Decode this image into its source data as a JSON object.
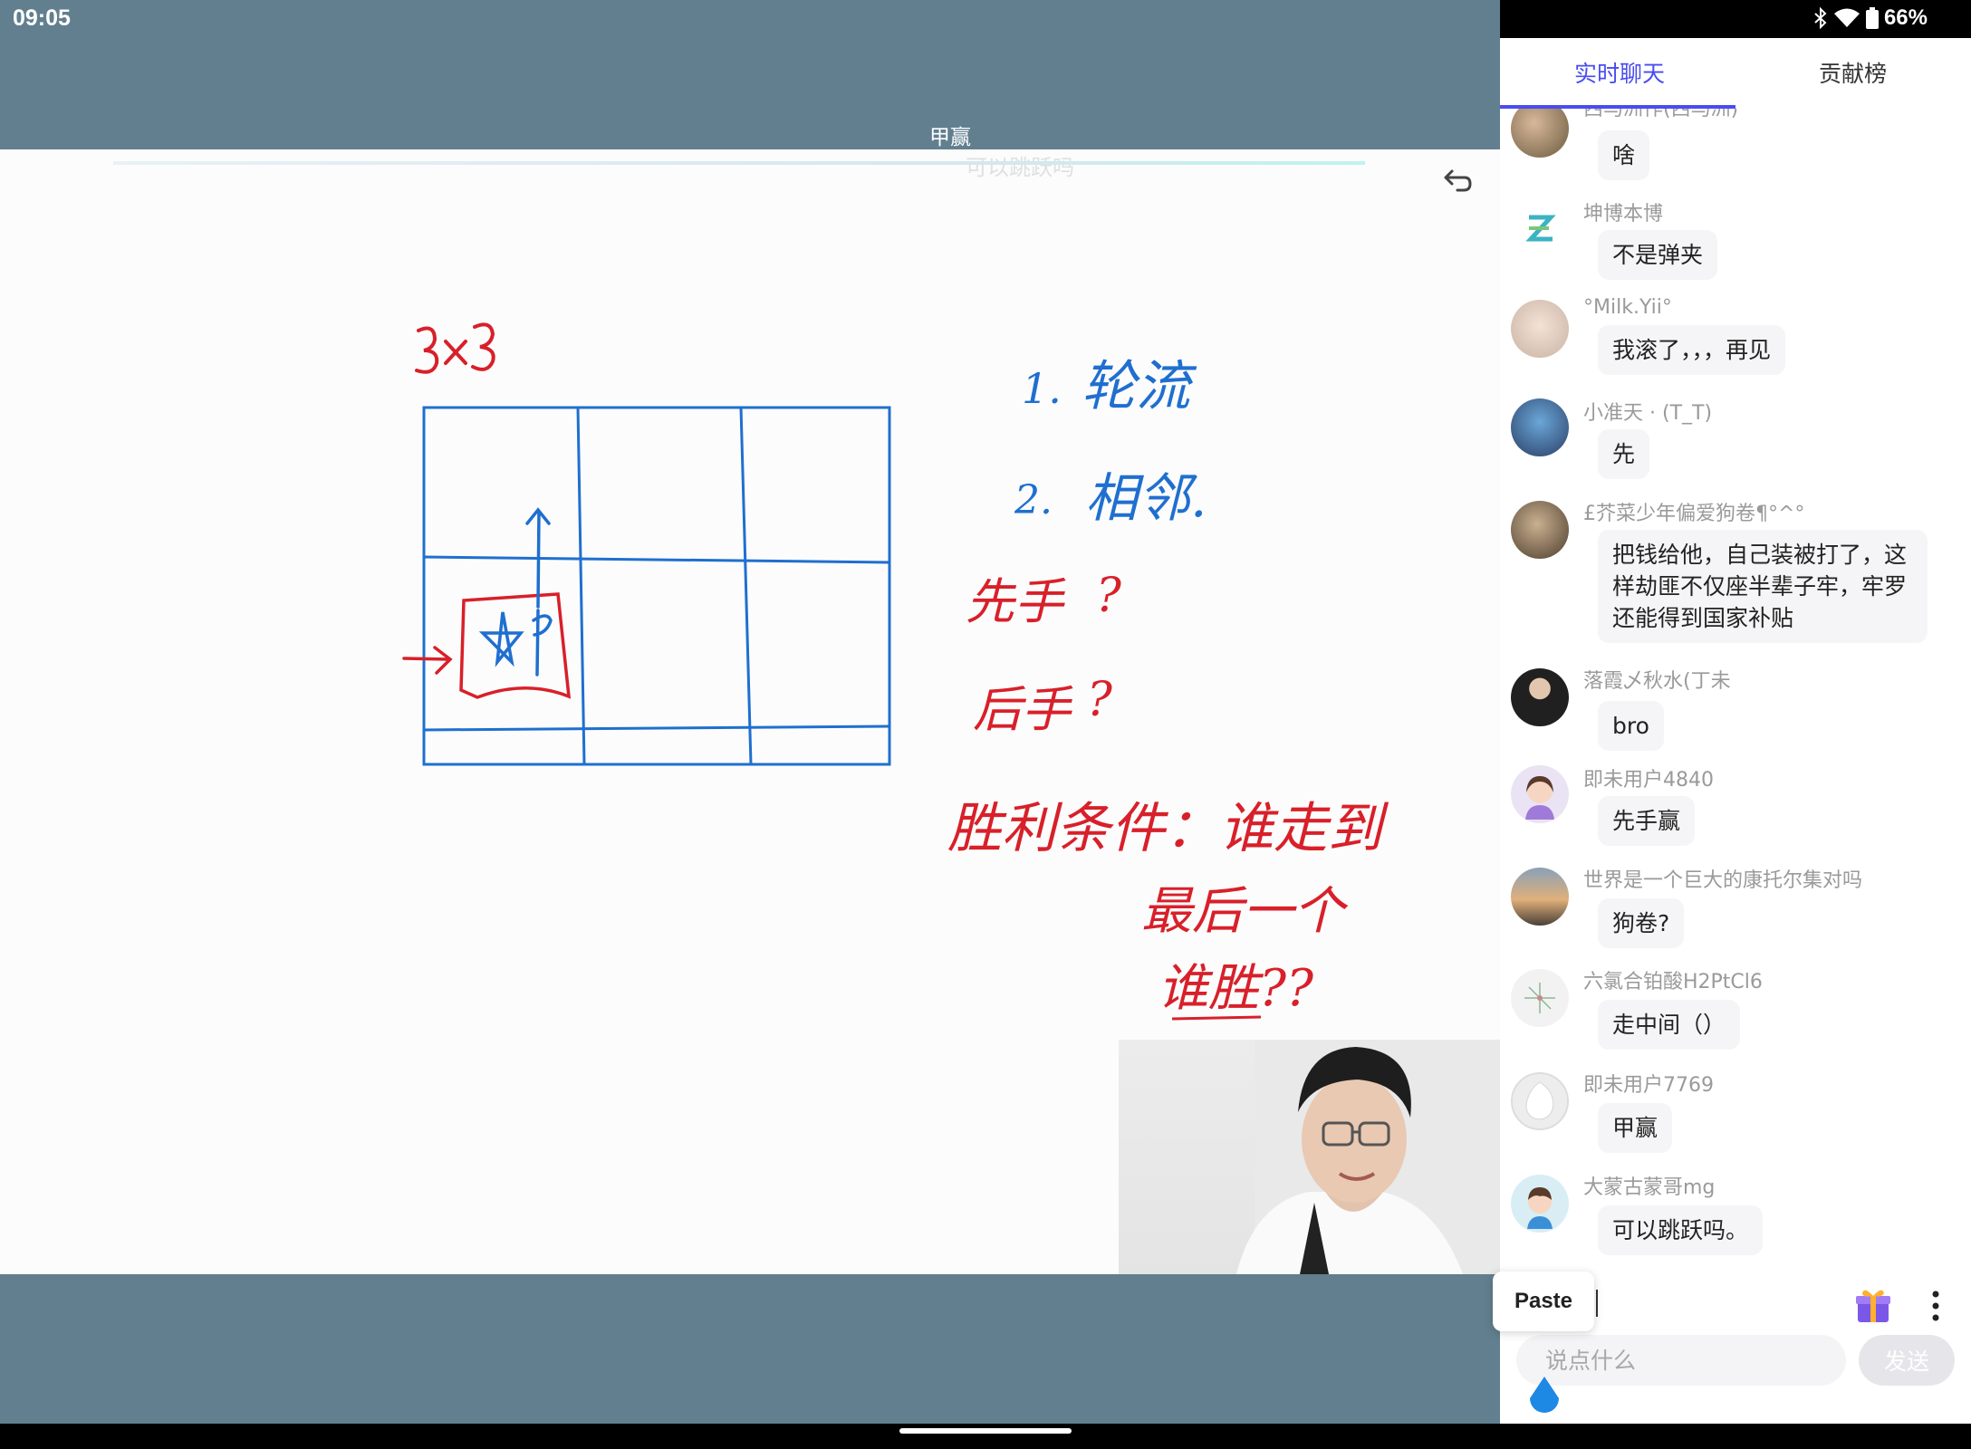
{
  "status_bar": {
    "time": "09:05",
    "battery": "66%"
  },
  "live": {
    "danmaku_top": "甲赢",
    "danmaku_ghost": "可以跳跃吗"
  },
  "whiteboard": {
    "ink_blue": "#1f6fd0",
    "ink_red": "#d8202a"
  },
  "tabs": [
    {
      "label": "实时聊天",
      "active": true
    },
    {
      "label": "贡献榜",
      "active": false
    }
  ],
  "messages": [
    {
      "user": "西马洲作(西马洲)",
      "text": "啥",
      "avatar": "photo-avatar"
    },
    {
      "user": "坤博本博",
      "text": "不是弹夹",
      "avatar": "z-logo-avatar"
    },
    {
      "user": "°Milk.Yii°",
      "text": "我滚了，，，再见",
      "avatar": "photo-avatar"
    },
    {
      "user": "小准天 · (T_T)",
      "text": "先",
      "avatar": "photo-avatar"
    },
    {
      "user": "£芥菜少年偏爱狗卷¶°^°",
      "text": "把钱给他，自己装被打了，这样劫匪不仅座半辈子牢，牢罗还能得到国家补贴",
      "avatar": "photo-avatar"
    },
    {
      "user": "落霞乄秋水(丁未",
      "text": "bro",
      "avatar": "photo-avatar"
    },
    {
      "user": "即未用户4840",
      "text": "先手赢",
      "avatar": "cartoon-girl-avatar"
    },
    {
      "user": "世界是一个巨大的康托尔集对吗",
      "text": "狗卷?",
      "avatar": "photo-avatar"
    },
    {
      "user": "六氯合铂酸H2PtCl6",
      "text": "走中间（）",
      "avatar": "chemistry-avatar"
    },
    {
      "user": "即未用户7769",
      "text": "甲赢",
      "avatar": "photo-avatar"
    },
    {
      "user": "大蒙古蒙哥mg",
      "text": "可以跳跃吗。",
      "avatar": "cartoon-boy-avatar"
    }
  ],
  "input": {
    "paste_label": "Paste",
    "placeholder": "说点什么",
    "send_label": "发送"
  }
}
